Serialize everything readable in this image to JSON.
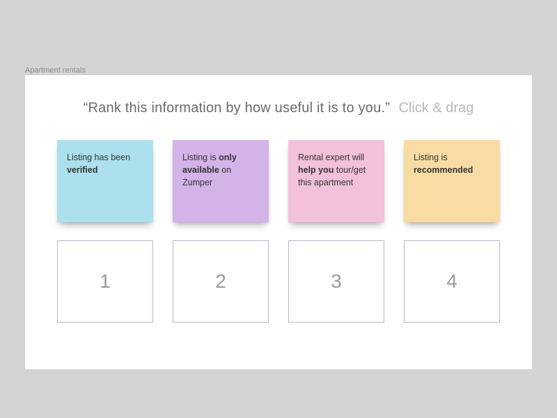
{
  "page_label": "Apartment rentals",
  "prompt": "“Rank this information by how useful it is to you.”",
  "hint": "Click & drag",
  "cards": [
    {
      "pre": "Listing has been ",
      "bold": "verified",
      "post": "",
      "color": "blue"
    },
    {
      "pre": "Listing is ",
      "bold": "only available",
      "post": " on Zumper",
      "color": "purple"
    },
    {
      "pre": "Rental expert will ",
      "bold": "help you",
      "post": " tour/get this apartment",
      "color": "pink"
    },
    {
      "pre": "Listing is ",
      "bold": "recommended",
      "post": "",
      "color": "yellow"
    }
  ],
  "slots": [
    "1",
    "2",
    "3",
    "4"
  ]
}
